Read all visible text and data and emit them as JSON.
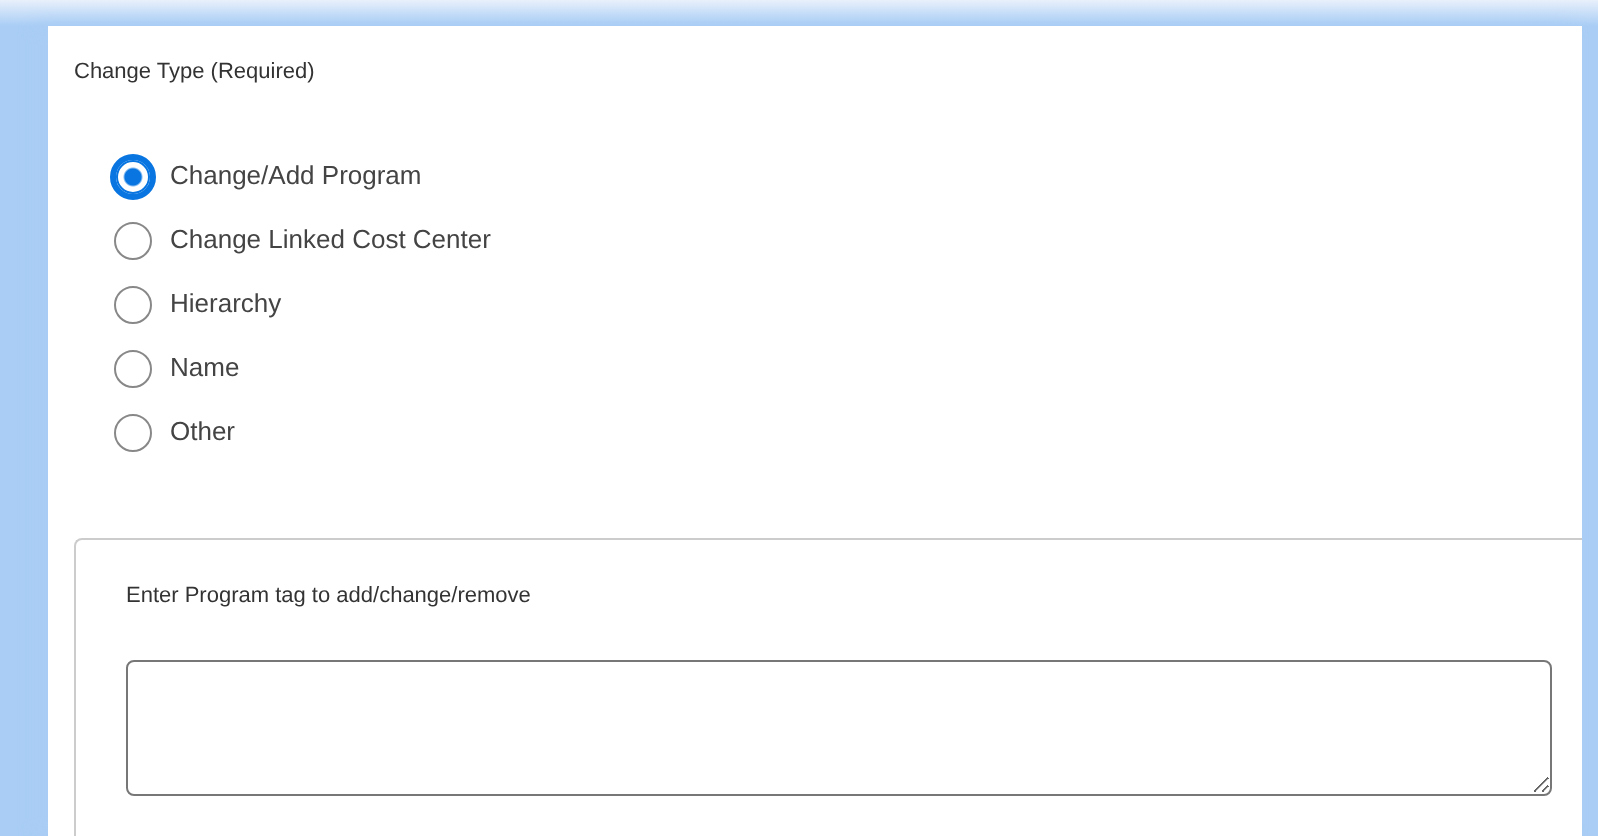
{
  "field_label": "Change Type (Required)",
  "options": [
    {
      "label": "Change/Add Program",
      "selected": true
    },
    {
      "label": "Change Linked Cost Center",
      "selected": false
    },
    {
      "label": "Hierarchy",
      "selected": false
    },
    {
      "label": "Name",
      "selected": false
    },
    {
      "label": "Other",
      "selected": false
    }
  ],
  "program_tag": {
    "label": "Enter Program tag to add/change/remove"
  }
}
